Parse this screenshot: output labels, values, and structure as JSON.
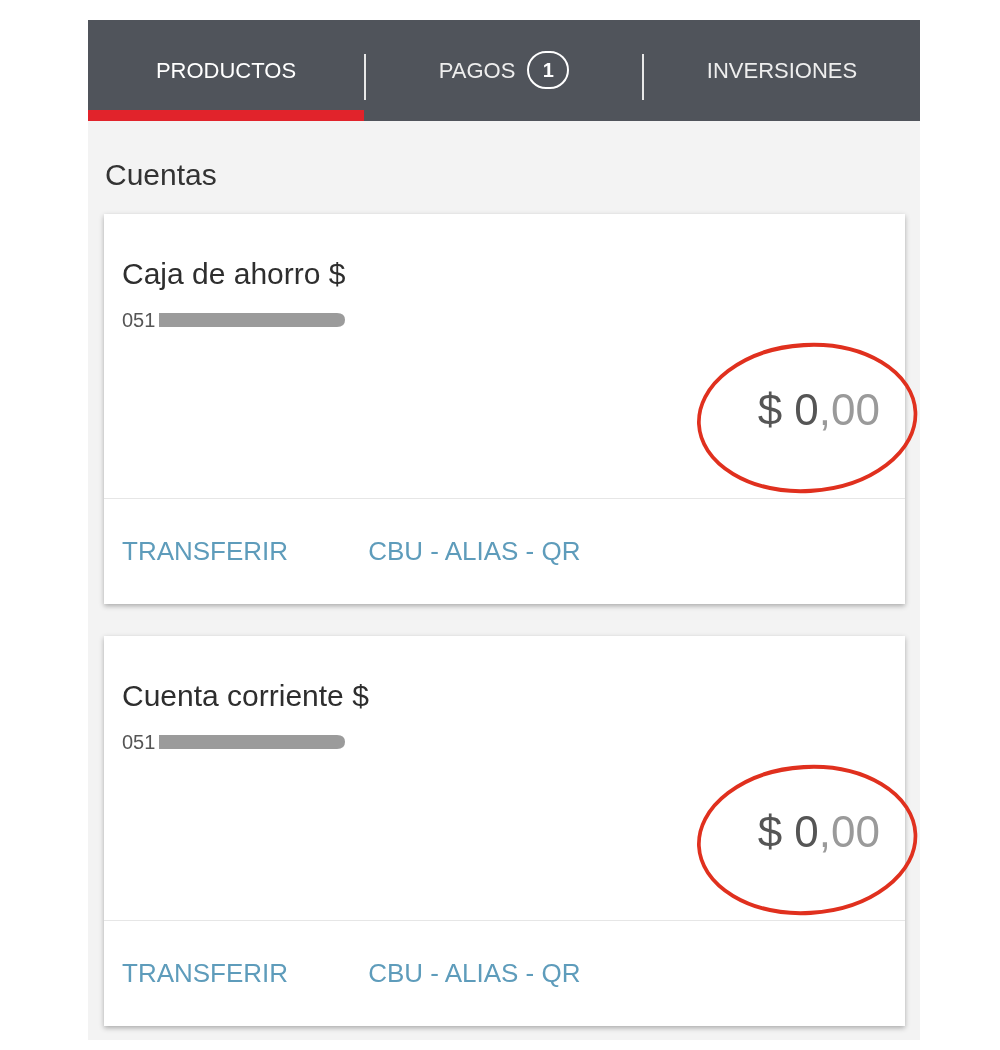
{
  "tabs": [
    {
      "label": "PRODUCTOS",
      "selected": true
    },
    {
      "label": "PAGOS",
      "badge": "1",
      "selected": false
    },
    {
      "label": "INVERSIONES",
      "selected": false
    }
  ],
  "section_title": "Cuentas",
  "accounts": [
    {
      "name": "Caja de ahorro $",
      "number": "051",
      "number_redacted": true,
      "balance": {
        "whole": "$ 0",
        "fraction": ",00"
      },
      "highlighted": true,
      "actions": [
        "TRANSFERIR",
        "CBU - ALIAS - QR"
      ]
    },
    {
      "name": "Cuenta corriente $",
      "number": "051",
      "number_redacted": true,
      "balance": {
        "whole": "$ 0",
        "fraction": ",00"
      },
      "highlighted": true,
      "actions": [
        "TRANSFERIR",
        "CBU - ALIAS - QR"
      ]
    }
  ]
}
